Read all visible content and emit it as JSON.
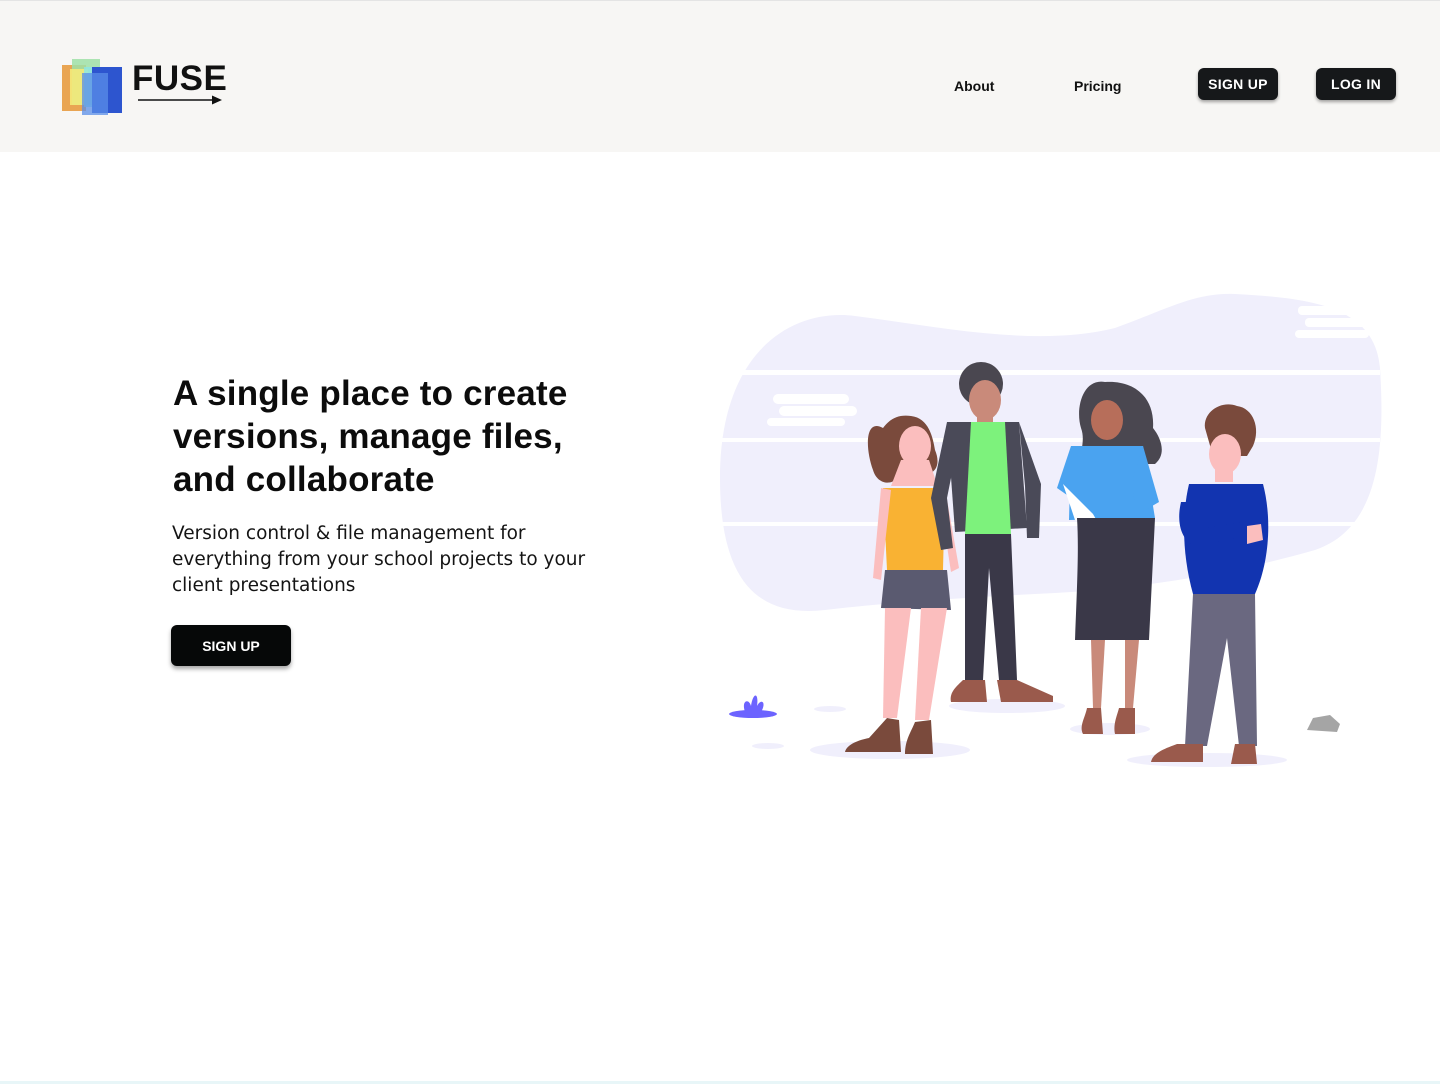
{
  "brand": {
    "name": "FUSE",
    "logo_colors": [
      "#e8a04a",
      "#f4ea7a",
      "#7ee0b8",
      "#2d55cf"
    ]
  },
  "nav": {
    "links": [
      {
        "label": "About"
      },
      {
        "label": "Pricing"
      }
    ],
    "signup_label": "SIGN UP",
    "login_label": "LOG IN"
  },
  "hero": {
    "title": "A single place to create versions, manage files, and collaborate",
    "subtitle": "Version control & file management for everything from your school projects to your client presentations",
    "cta_label": "SIGN UP"
  },
  "colors": {
    "header_bg": "#f7f6f4",
    "button_bg": "#16181a",
    "blob": "#f0effc",
    "accent_purple": "#6c63ff"
  }
}
